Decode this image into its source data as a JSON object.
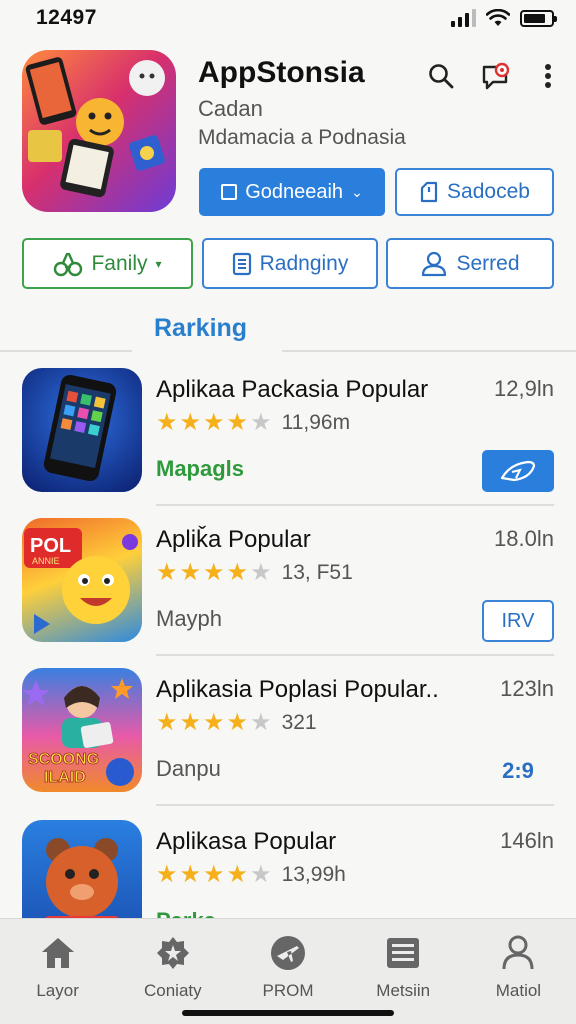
{
  "status_bar": {
    "time": "12497"
  },
  "header": {
    "title": "AppStonsia",
    "subtitle": "Cadan",
    "description": "Mdamacia a Podnasia",
    "primary_button": "Godneeaih",
    "secondary_button": "Sadoceb",
    "icons": [
      "search-icon",
      "chat-badge-icon",
      "more-vertical-icon"
    ]
  },
  "filters": [
    {
      "label": "Fanily",
      "icon": "binoculars-icon",
      "color": "#3fa34d"
    },
    {
      "label": "Radnginy",
      "icon": "list-icon",
      "color": "#3b83d6"
    },
    {
      "label": "Serred",
      "icon": "user-icon",
      "color": "#3b83d6"
    }
  ],
  "section": {
    "title": "Rarking"
  },
  "apps": [
    {
      "name": "Aplikaa Packasia Popular",
      "size": "12,9ln",
      "stars": 4,
      "rating": "11,96m",
      "tag": "Mapagls",
      "action": ""
    },
    {
      "name": "Apliǩa Popular",
      "size": "18.0ln",
      "stars": 4,
      "rating": "13, F51",
      "tag": "Mayph",
      "action": "IRV",
      "icon_text": [
        "POL",
        "ANNIE"
      ]
    },
    {
      "name": "Aplikasia Poplasi Popular..",
      "size": "123ln",
      "stars": 4,
      "rating": "321",
      "tag": "Danpu",
      "action": "2:9",
      "icon_text": [
        "SCOONG",
        "ILAID"
      ]
    },
    {
      "name": "Aplikasa Popular",
      "size": "146ln",
      "stars": 4,
      "rating": "13,99h",
      "tag": "Parka",
      "action": ""
    }
  ],
  "tabs": [
    {
      "label": "Layor",
      "icon": "home-icon"
    },
    {
      "label": "Coniaty",
      "icon": "badge-star-icon"
    },
    {
      "label": "PROM",
      "icon": "plane-icon"
    },
    {
      "label": "Metsiin",
      "icon": "list-icon"
    },
    {
      "label": "Matiol",
      "icon": "user-icon"
    }
  ],
  "colors": {
    "accent": "#2a7fdc",
    "green": "#3fa34d",
    "star": "#f5b01c"
  }
}
